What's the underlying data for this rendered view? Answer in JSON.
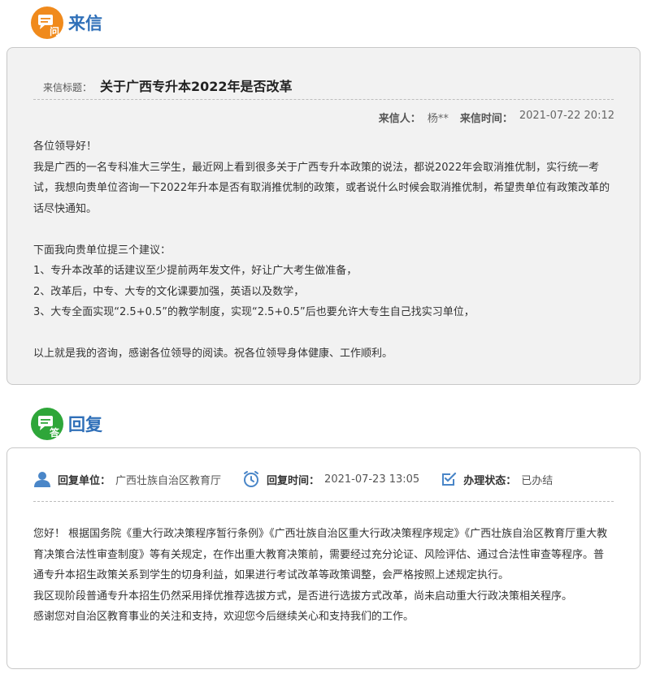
{
  "letter_section": {
    "heading": "来信",
    "badge_glyph": "问",
    "badge_color": "#f08a1c",
    "subject_label": "来信标题：",
    "subject": "关于广西专升本2022年是否改革",
    "sender_label": "来信人：",
    "sender": "杨**",
    "time_label": "来信时间：",
    "time": "2021-07-22 20:12",
    "paragraphs": [
      "各位领导好！",
      "我是广西的一名专科准大三学生，最近网上看到很多关于广西专升本政策的说法，都说2022年会取消推优制，实行统一考试，我想向贵单位咨询一下2022年升本是否有取消推优制的政策，或者说什么时候会取消推优制，希望贵单位有政策改革的话尽快通知。",
      "",
      "下面我向贵单位提三个建议：",
      "1、专升本改革的话建议至少提前两年发文件，好让广大考生做准备，",
      "2、改革后，中专、大专的文化课要加强，英语以及数学，",
      "3、大专全面实现“2.5+0.5”的教学制度，实现“2.5+0.5”后也要允许大专生自己找实习单位，",
      "",
      "以上就是我的咨询，感谢各位领导的阅读。祝各位领导身体健康、工作顺利。"
    ]
  },
  "reply_section": {
    "heading": "回复",
    "badge_glyph": "答",
    "badge_color": "#2ea639",
    "unit_label": "回复单位：",
    "unit": "广西壮族自治区教育厅",
    "time_label": "回复时间：",
    "time": "2021-07-23 13:05",
    "status_label": "办理状态：",
    "status": "已办结",
    "accent_color": "#4a86c8",
    "paragraphs": [
      "您好！ 根据国务院《重大行政决策程序暂行条例》《广西壮族自治区重大行政决策程序规定》《广西壮族自治区教育厅重大教育决策合法性审查制度》等有关规定，在作出重大教育决策前，需要经过充分论证、风险评估、通过合法性审查等程序。普通专升本招生政策关系到学生的切身利益，如果进行考试改革等政策调整，会严格按照上述规定执行。",
      "我区现阶段普通专升本招生仍然采用择优推荐选拔方式，是否进行选拔方式改革，尚未启动重大行政决策相关程序。",
      "感谢您对自治区教育事业的关注和支持，欢迎您今后继续关心和支持我们的工作。"
    ]
  }
}
